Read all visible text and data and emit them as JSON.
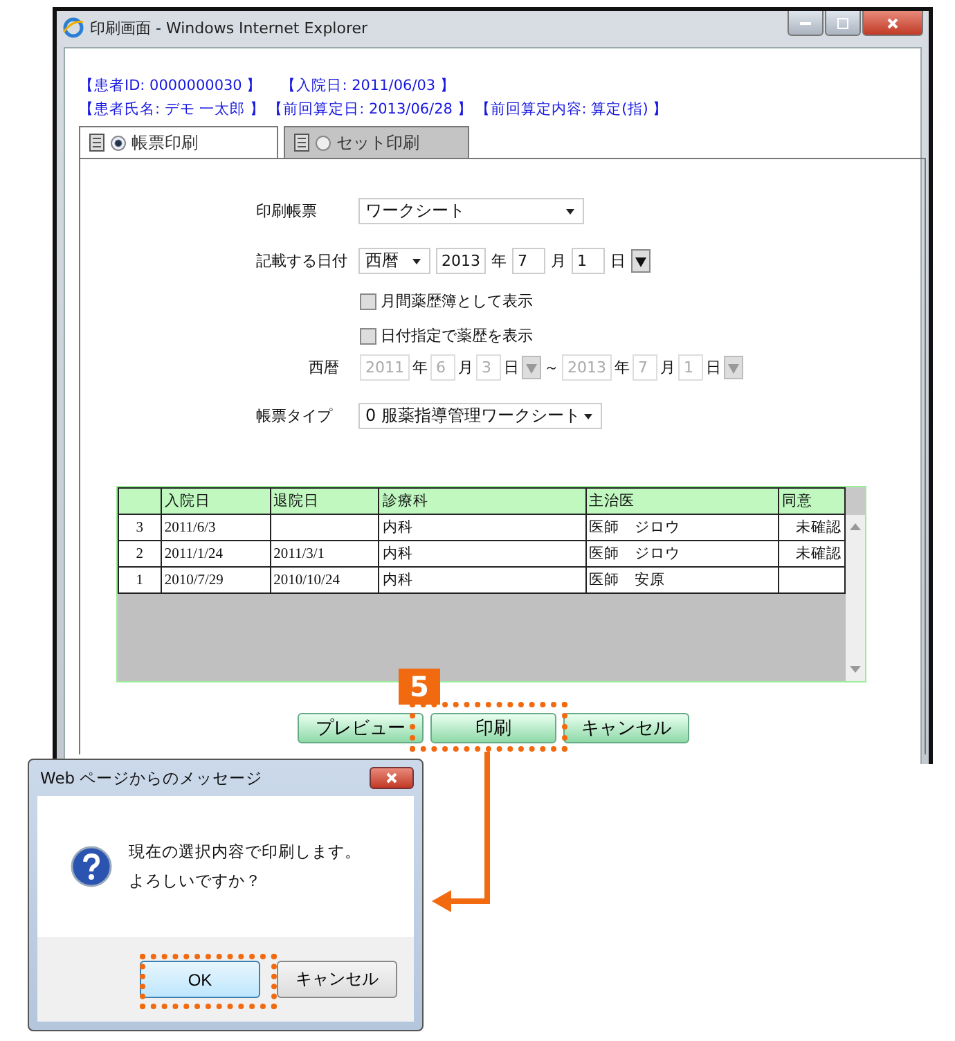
{
  "window": {
    "title": "印刷画面 - Windows Internet Explorer"
  },
  "patient_info": [
    [
      "【患者ID:  0000000030 】",
      "【入院日:  2011/06/03 】"
    ],
    [
      "【患者氏名:  デモ  一太郎 】",
      "【前回算定日:  2013/06/28 】",
      "【前回算定内容:  算定(指) 】"
    ]
  ],
  "tabs": [
    {
      "label": "帳票印刷",
      "selected": true
    },
    {
      "label": "セット印刷",
      "selected": false
    }
  ],
  "form": {
    "report": {
      "label": "印刷帳票",
      "value": "ワークシート"
    },
    "date": {
      "label": "記載する日付",
      "era": "西暦",
      "parts": [
        {
          "value": "2013",
          "unit": "年"
        },
        {
          "value": "7",
          "unit": "月"
        },
        {
          "value": "1",
          "unit": "日"
        }
      ]
    },
    "checkboxes": [
      {
        "label": "月間薬歴簿として表示",
        "checked": false
      },
      {
        "label": "日付指定で薬歴を表示",
        "checked": false
      }
    ],
    "range": {
      "label": "西暦",
      "disabled": true,
      "from": [
        {
          "value": "2011",
          "unit": "年"
        },
        {
          "value": "6",
          "unit": "月"
        },
        {
          "value": "3",
          "unit": "日"
        }
      ],
      "separator": "～",
      "to": [
        {
          "value": "2013",
          "unit": "年"
        },
        {
          "value": "7",
          "unit": "月"
        },
        {
          "value": "1",
          "unit": "日"
        }
      ]
    },
    "type": {
      "label": "帳票タイプ",
      "value": "0 服薬指導管理ワークシート"
    }
  },
  "table": {
    "columns": [
      "入院日",
      "退院日",
      "診療科",
      "主治医",
      "同意"
    ],
    "rows": [
      {
        "no": "3",
        "cells": [
          "2011/6/3",
          null,
          "内科",
          "医師　ジロウ",
          "未確認"
        ]
      },
      {
        "no": "2",
        "cells": [
          "2011/1/24",
          "2011/3/1",
          "内科",
          "医師　ジロウ",
          "未確認"
        ]
      },
      {
        "no": "1",
        "cells": [
          "2010/7/29",
          "2010/10/24",
          "内科",
          "医師　安原",
          null
        ]
      }
    ]
  },
  "buttons": [
    "プレビュー",
    "印刷",
    "キャンセル"
  ],
  "step_badge": "5",
  "dialog": {
    "title": "Web ページからのメッセージ",
    "message": [
      "現在の選択内容で印刷します。",
      "よろしいですか？"
    ],
    "buttons": [
      "OK",
      "キャンセル"
    ]
  }
}
